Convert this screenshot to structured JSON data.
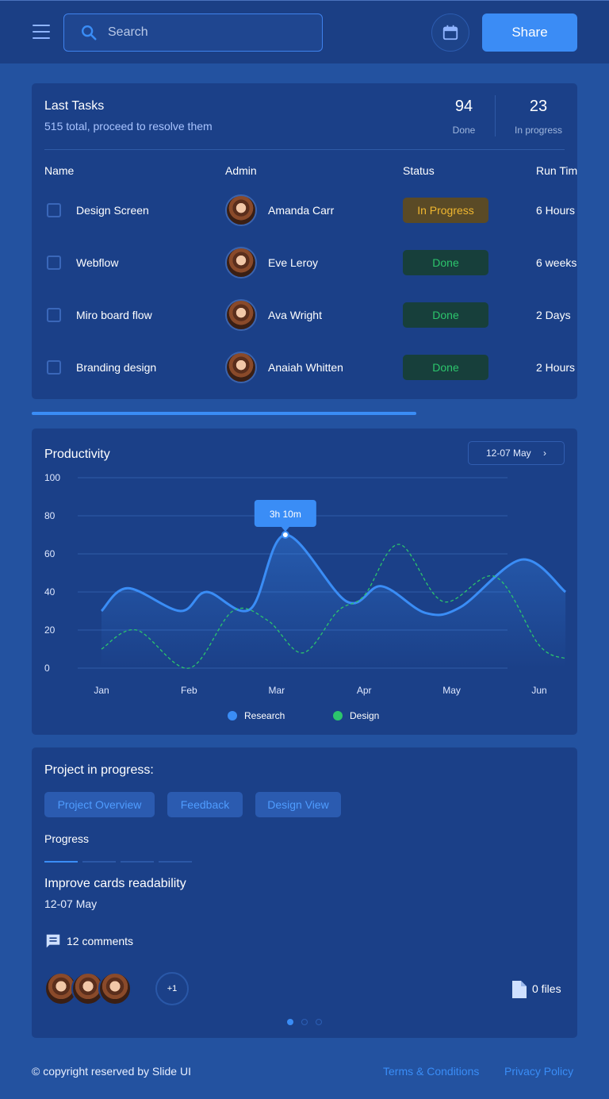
{
  "header": {
    "search_placeholder": "Search",
    "share_label": "Share",
    "icons": [
      "menu-icon",
      "search-icon",
      "calendar-icon"
    ]
  },
  "tasks": {
    "title": "Last Tasks",
    "subtitle": "515 total, proceed to resolve them",
    "stats": [
      {
        "value": "94",
        "label": "Done"
      },
      {
        "value": "23",
        "label": "In progress"
      }
    ],
    "columns": [
      "Name",
      "Admin",
      "Status",
      "Run Time"
    ],
    "rows": [
      {
        "name": "Design Screen",
        "admin": "Amanda Carr",
        "status": "In Progress",
        "run_time": "6 Hours"
      },
      {
        "name": "Webflow",
        "admin": "Eve Leroy",
        "status": "Done",
        "run_time": "6 weeks"
      },
      {
        "name": "Miro board flow",
        "admin": "Ava Wright",
        "status": "Done",
        "run_time": "2 Days"
      },
      {
        "name": "Branding design",
        "admin": "Anaiah Whitten",
        "status": "Done",
        "run_time": "2 Hours"
      }
    ],
    "status_colors": {
      "In Progress": "#f0b730",
      "Done": "#2cc56c"
    }
  },
  "productivity": {
    "title": "Productivity",
    "date_range": "12-07 May",
    "tooltip": "3h 10m"
  },
  "chart_data": {
    "type": "line",
    "x": [
      "Jan",
      "Feb",
      "Mar",
      "Apr",
      "May",
      "Jun"
    ],
    "ylim": [
      0,
      100
    ],
    "yticks": [
      0,
      20,
      40,
      60,
      80,
      100
    ],
    "grid": true,
    "legend_position": "bottom",
    "series": [
      {
        "name": "Research",
        "color": "#3a8df6",
        "points": [
          [
            0,
            30
          ],
          [
            0.3,
            42
          ],
          [
            0.9,
            30
          ],
          [
            1.2,
            40
          ],
          [
            1.7,
            31
          ],
          [
            2.1,
            70
          ],
          [
            2.8,
            35
          ],
          [
            3.2,
            43
          ],
          [
            3.7,
            29
          ],
          [
            4.1,
            32
          ],
          [
            4.8,
            57
          ],
          [
            5.3,
            40
          ]
        ]
      },
      {
        "name": "Design",
        "color": "#2cc56c",
        "points": [
          [
            0,
            10
          ],
          [
            0.4,
            20
          ],
          [
            1.0,
            0
          ],
          [
            1.5,
            30
          ],
          [
            1.9,
            25
          ],
          [
            2.3,
            8
          ],
          [
            2.7,
            30
          ],
          [
            3.0,
            38
          ],
          [
            3.4,
            65
          ],
          [
            3.9,
            35
          ],
          [
            4.5,
            48
          ],
          [
            5.0,
            12
          ],
          [
            5.3,
            5
          ]
        ]
      }
    ]
  },
  "project": {
    "title": "Project in progress:",
    "tabs": [
      "Project Overview",
      "Feedback",
      "Design View"
    ],
    "progress_label": "Progress",
    "progress_steps_total": 4,
    "progress_steps_done": 1,
    "task_name": "Improve cards readability",
    "task_date": "12-07 May",
    "comments": "12 comments",
    "more_members": "+1",
    "files": "0 files",
    "pager_pages": 3,
    "pager_current": 1
  },
  "footer": {
    "copyright": "© copyright reserved by Slide UI",
    "terms": "Terms & Conditions",
    "privacy": "Privacy Policy"
  }
}
